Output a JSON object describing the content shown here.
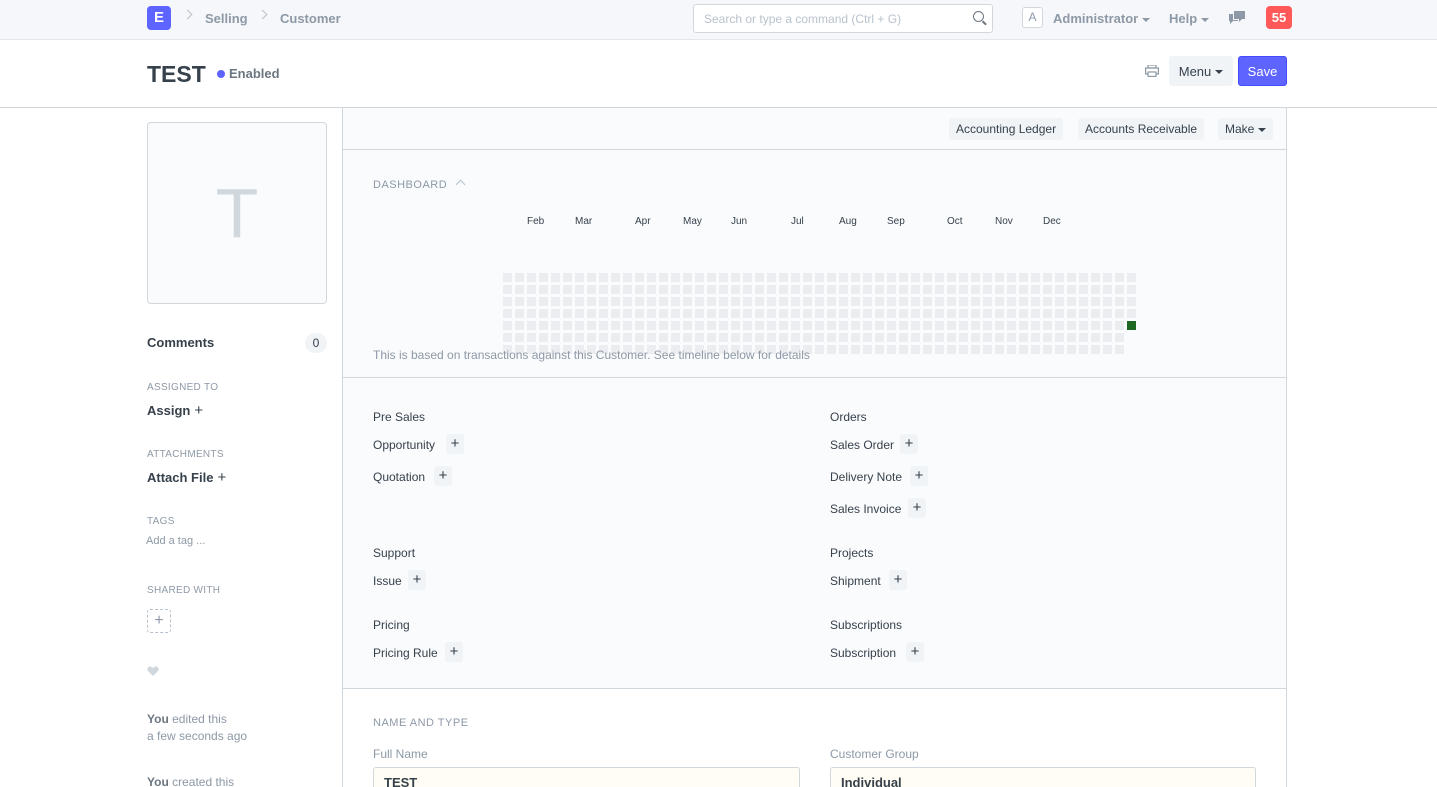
{
  "navbar": {
    "logo_letter": "E",
    "breadcrumbs": [
      "Selling",
      "Customer"
    ],
    "search_placeholder": "Search or type a command (Ctrl + G)",
    "user_initial": "A",
    "user_name": "Administrator",
    "help_label": "Help",
    "notification_count": "55"
  },
  "page_head": {
    "title": "TEST",
    "status": "Enabled",
    "menu_label": "Menu",
    "save_label": "Save"
  },
  "sidebar": {
    "image_letter": "T",
    "comments_label": "Comments",
    "comments_count": "0",
    "assigned_heading": "ASSIGNED TO",
    "assign_label": "Assign",
    "attachments_heading": "ATTACHMENTS",
    "attach_label": "Attach File",
    "tags_heading": "TAGS",
    "add_tag": "Add a tag ...",
    "shared_heading": "SHARED WITH",
    "edited_by": "You",
    "edited_text": " edited this",
    "edited_time": "a few seconds ago",
    "created_by": "You",
    "created_text": " created this"
  },
  "toolbar": {
    "accounting_ledger": "Accounting Ledger",
    "accounts_receivable": "Accounts Receivable",
    "make": "Make"
  },
  "dashboard": {
    "heading": "DASHBOARD",
    "months": [
      "Feb",
      "Mar",
      "Apr",
      "May",
      "Jun",
      "Jul",
      "Aug",
      "Sep",
      "Oct",
      "Nov",
      "Dec"
    ],
    "note": "This is based on transactions against this Customer. See timeline below for details",
    "active_color": "#1e6823",
    "empty_color": "#ebedf0"
  },
  "links": {
    "pre_sales": {
      "title": "Pre Sales",
      "items": [
        "Opportunity",
        "Quotation"
      ]
    },
    "orders": {
      "title": "Orders",
      "items": [
        "Sales Order",
        "Delivery Note",
        "Sales Invoice"
      ]
    },
    "support": {
      "title": "Support",
      "items": [
        "Issue"
      ]
    },
    "projects": {
      "title": "Projects",
      "items": [
        "Shipment"
      ]
    },
    "pricing": {
      "title": "Pricing",
      "items": [
        "Pricing Rule"
      ]
    },
    "subscriptions": {
      "title": "Subscriptions",
      "items": [
        "Subscription"
      ]
    }
  },
  "name_and_type": {
    "heading": "NAME AND TYPE",
    "full_name_label": "Full Name",
    "full_name_value": "TEST",
    "customer_group_label": "Customer Group",
    "customer_group_value": "Individual"
  }
}
